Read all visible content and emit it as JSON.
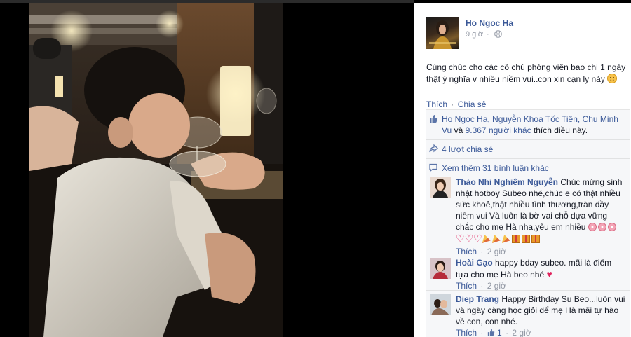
{
  "post": {
    "page_name": "Ho Ngoc Ha",
    "time": "9 giờ",
    "text": "Cùng chúc cho các cô chú phóng viên bao chi 1 ngày thật ý nghĩa v nhiều niềm vui..con xin cạn ly này",
    "actions": {
      "like": "Thích",
      "sep": "·",
      "share": "Chia sẻ"
    }
  },
  "ufi": {
    "likers_names": "Ho Ngoc Ha, Nguyễn Khoa Tốc Tiên, Chu Minh Vu",
    "likers_and": "và",
    "likers_others": "9.367 người khác",
    "likers_suffix": "thích điều này.",
    "shares": "4 lượt chia sẻ",
    "more_comments": "Xem thêm 31 bình luận khác"
  },
  "comments": [
    {
      "name": "Thảo Nhi Nghiêm Nguyễn",
      "text": "Chúc mừng sinh nhật hotboy Subeo nhé,chúc e có thật nhiều sức khoẻ,thật nhiều tình thương,tràn đầy niềm vui Và luôn là bờ vai chỗ dựa vững chắc cho mẹ Hà nha,yêu em nhiều",
      "like": "Thích",
      "time": "2 giờ"
    },
    {
      "name": "Hoài Gạo",
      "text": "happy bday subeo. mãi là điểm tựa cho mẹ Hà beo nhé",
      "like": "Thích",
      "time": "2 giờ"
    },
    {
      "name": "Diep Trang",
      "text": "Happy Birthday Su Beo...luôn vui và ngày càng học giỏi để mẹ Hà mãi tự hào về con, con nhé.",
      "like": "Thích",
      "likes_count": "1",
      "time": "2 giờ"
    }
  ],
  "colors": {
    "link": "#3b5998",
    "meta": "#9197a3",
    "ufi_bg": "#f6f7f9",
    "stage_bg": "#000000"
  },
  "icons": [
    "globe-icon",
    "like-thumb-icon",
    "share-arrow-icon",
    "comment-bubble-icon",
    "smile-emoji-icon",
    "heart-emoji-icon",
    "flower-emoji-icon",
    "party-popper-emoji-icon",
    "gift-emoji-icon"
  ]
}
